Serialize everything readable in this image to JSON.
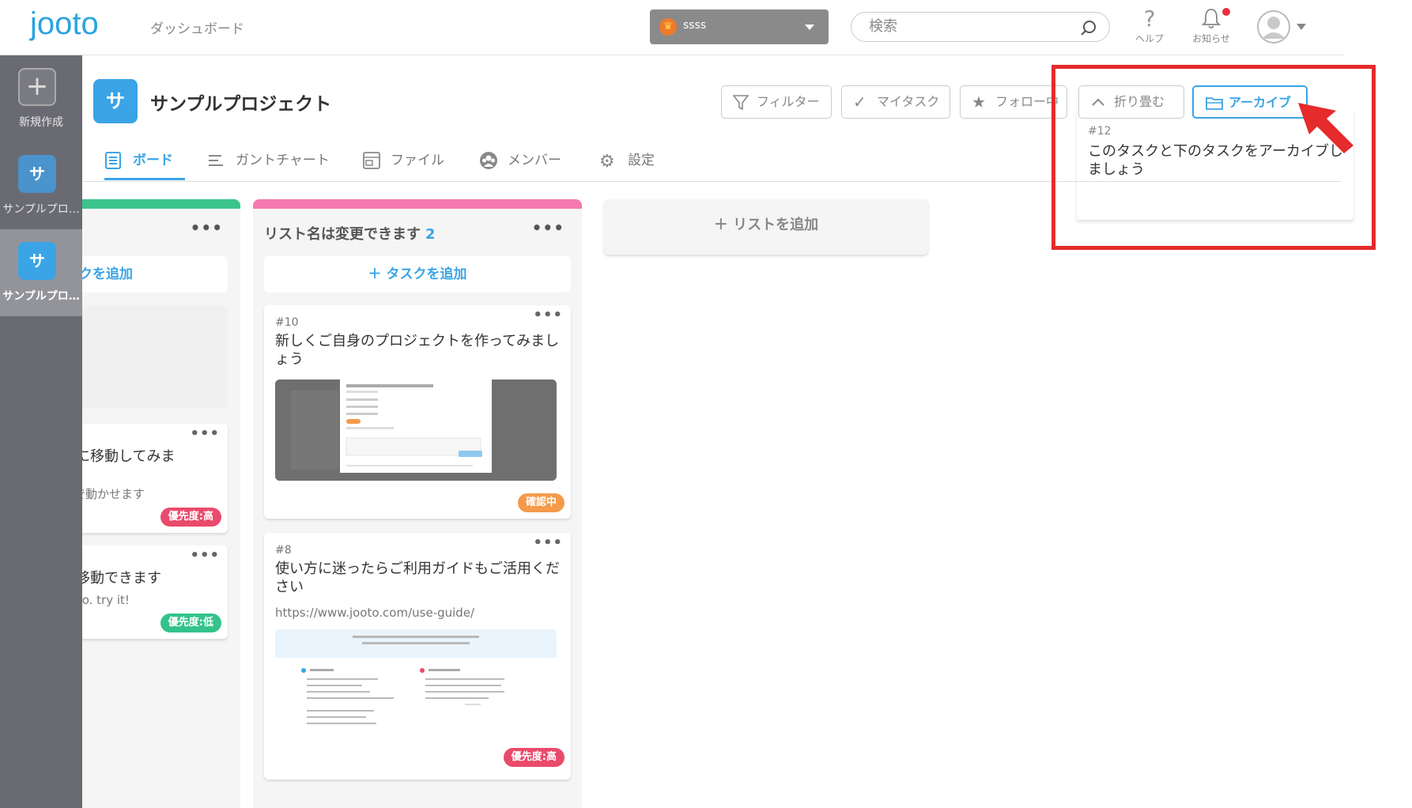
{
  "header": {
    "logo": "jooto",
    "dashboard_link": "ダッシュボード",
    "org_name": "ssss",
    "search_placeholder": "検索",
    "help_label": "ヘルプ",
    "notice_label": "お知らせ"
  },
  "sidebar": {
    "items": [
      {
        "icon_text": "+",
        "label": "新規作成"
      },
      {
        "icon_text": "サ",
        "label": "サンプルプロ…"
      },
      {
        "icon_text": "サ",
        "label": "サンプルプロ…"
      }
    ]
  },
  "project": {
    "icon_text": "サ",
    "title": "サンプルプロジェクト"
  },
  "toolbar": {
    "filter": "フィルター",
    "my_task": "マイタスク",
    "follow": "フォロー中",
    "collapse": "折り畳む",
    "archive": "アーカイブ"
  },
  "tabs": [
    {
      "label": "ボード",
      "icon": "board-icon"
    },
    {
      "label": "ガントチャート",
      "icon": "gantt-icon"
    },
    {
      "label": "ファイル",
      "icon": "file-icon"
    },
    {
      "label": "メンバー",
      "icon": "member-icon"
    },
    {
      "label": "設定",
      "icon": "gear-icon"
    }
  ],
  "lists": [
    {
      "add_task": "タスクを追加",
      "cards": [
        {
          "title": "トに移動してみま",
          "sub": "プで動かせます",
          "badge": "優先度:高"
        },
        {
          "title": "こ移動できます",
          "sub": "t too. try it!",
          "badge": "優先度:低"
        }
      ]
    },
    {
      "name": "リスト名は変更できます",
      "count": "2",
      "add_task": "タスクを追加",
      "cards": [
        {
          "num": "#10",
          "title": "新しくご自身のプロジェクトを作ってみましょう",
          "badge": "確認中"
        },
        {
          "num": "#8",
          "title": "使い方に迷ったらご利用ガイドもご活用ください",
          "url": "https://www.jooto.com/use-guide/",
          "badge": "優先度:高"
        }
      ]
    }
  ],
  "add_list": "リストを追加",
  "archive_panel": {
    "num": "#12",
    "title": "このタスクと下のタスクをアーカイブしましょう"
  },
  "colors": {
    "accent": "#3aa4e6",
    "sidebar": "#6a6b72",
    "list1_top": "#3dc48d",
    "list2_top": "#f479b0",
    "annotation": "#e52b2b"
  }
}
